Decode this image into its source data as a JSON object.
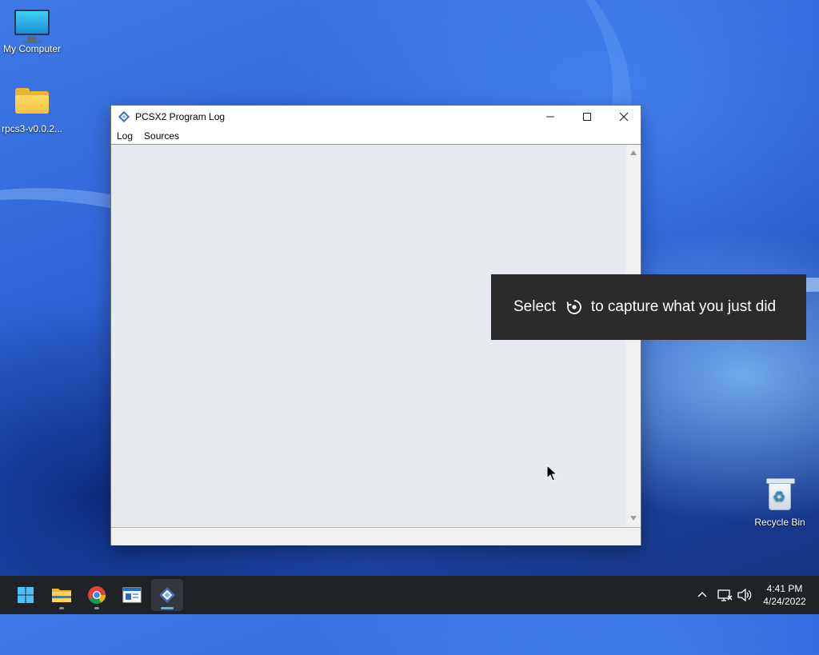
{
  "desktop": {
    "icons": [
      {
        "label": "My Computer",
        "icon": "monitor-icon"
      },
      {
        "label": "rpcs3-v0.0.2...",
        "icon": "folder-icon"
      },
      {
        "label": "Recycle Bin",
        "icon": "recycle-bin-icon"
      }
    ]
  },
  "window": {
    "title": "PCSX2 Program Log",
    "icon": "pcsx2-icon",
    "controls": {
      "minimize": "—",
      "maximize": "☐",
      "close": "✕"
    },
    "menu": [
      "Log",
      "Sources"
    ]
  },
  "toast": {
    "prefix": "Select",
    "icon": "capture-record-icon",
    "suffix": "to capture what you just did"
  },
  "taskbar": {
    "items": [
      {
        "name": "start",
        "icon": "windows-start-icon"
      },
      {
        "name": "file-explorer",
        "icon": "folder-icon"
      },
      {
        "name": "chrome",
        "icon": "chrome-icon"
      },
      {
        "name": "app",
        "icon": "window-app-icon"
      },
      {
        "name": "pcsx2",
        "icon": "pcsx2-icon",
        "active": true
      }
    ],
    "tray": {
      "icons": [
        "chevron-up-icon",
        "network-icon",
        "volume-icon"
      ],
      "time": "4:41 PM",
      "date": "4/24/2022"
    }
  },
  "colors": {
    "window_bg": "#f0f0f0",
    "log_bg": "#e6eaee",
    "toast_bg": "#2b2b2b",
    "taskbar_bg": "#1f2227",
    "accent": "#5fb2f2"
  }
}
